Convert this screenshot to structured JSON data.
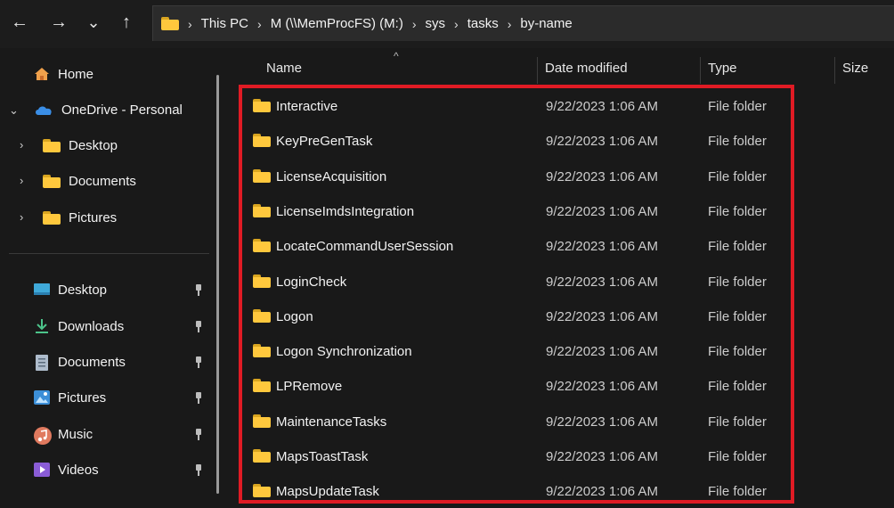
{
  "nav": {
    "back_glyph": "←",
    "forward_glyph": "→",
    "recent_glyph": "⌄",
    "up_glyph": "↑"
  },
  "breadcrumbs": [
    "This PC",
    "M (\\\\MemProcFS) (M:)",
    "sys",
    "tasks",
    "by-name"
  ],
  "sidebar": {
    "home": "Home",
    "onedrive": "OneDrive - Personal",
    "onedrive_children": [
      "Desktop",
      "Documents",
      "Pictures"
    ],
    "quick_access": [
      {
        "label": "Desktop",
        "icon": "desktop-icon"
      },
      {
        "label": "Downloads",
        "icon": "download-icon"
      },
      {
        "label": "Documents",
        "icon": "document-icon"
      },
      {
        "label": "Pictures",
        "icon": "pictures-icon"
      },
      {
        "label": "Music",
        "icon": "music-icon"
      },
      {
        "label": "Videos",
        "icon": "videos-icon"
      }
    ]
  },
  "columns": {
    "name": "Name",
    "date": "Date modified",
    "type": "Type",
    "size": "Size"
  },
  "files": [
    {
      "name": "Interactive",
      "date": "9/22/2023 1:06 AM",
      "type": "File folder"
    },
    {
      "name": "KeyPreGenTask",
      "date": "9/22/2023 1:06 AM",
      "type": "File folder"
    },
    {
      "name": "LicenseAcquisition",
      "date": "9/22/2023 1:06 AM",
      "type": "File folder"
    },
    {
      "name": "LicenseImdsIntegration",
      "date": "9/22/2023 1:06 AM",
      "type": "File folder"
    },
    {
      "name": "LocateCommandUserSession",
      "date": "9/22/2023 1:06 AM",
      "type": "File folder"
    },
    {
      "name": "LoginCheck",
      "date": "9/22/2023 1:06 AM",
      "type": "File folder"
    },
    {
      "name": "Logon",
      "date": "9/22/2023 1:06 AM",
      "type": "File folder"
    },
    {
      "name": "Logon Synchronization",
      "date": "9/22/2023 1:06 AM",
      "type": "File folder"
    },
    {
      "name": "LPRemove",
      "date": "9/22/2023 1:06 AM",
      "type": "File folder"
    },
    {
      "name": "MaintenanceTasks",
      "date": "9/22/2023 1:06 AM",
      "type": "File folder"
    },
    {
      "name": "MapsToastTask",
      "date": "9/22/2023 1:06 AM",
      "type": "File folder"
    },
    {
      "name": "MapsUpdateTask",
      "date": "9/22/2023 1:06 AM",
      "type": "File folder"
    }
  ],
  "colors": {
    "highlight": "#e01b24",
    "folder": "#ffc83d",
    "background": "#191919"
  }
}
